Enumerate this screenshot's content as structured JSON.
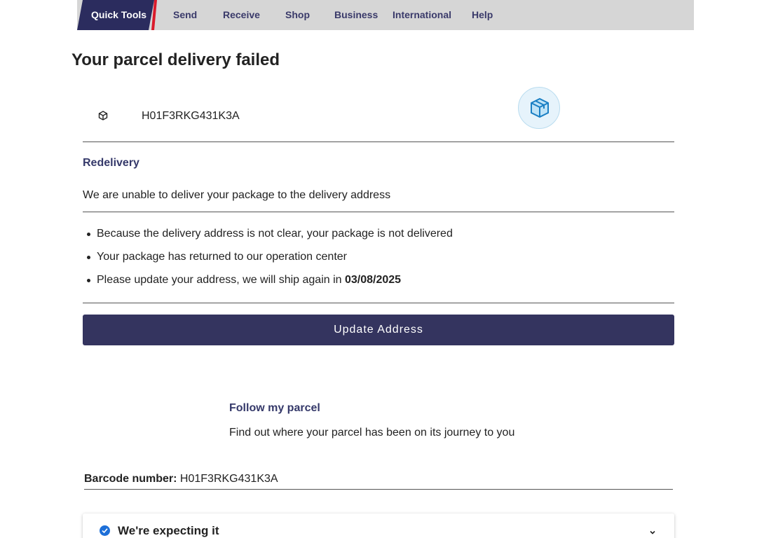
{
  "nav": {
    "items": [
      {
        "label": "Quick Tools",
        "active": true
      },
      {
        "label": "Send"
      },
      {
        "label": "Receive"
      },
      {
        "label": "Shop"
      },
      {
        "label": "Business"
      },
      {
        "label": "International"
      },
      {
        "label": "Help"
      }
    ]
  },
  "page": {
    "title": "Your parcel delivery failed"
  },
  "tracking": {
    "code": "H01F3RKG431K3A",
    "small_icon": "package-icon",
    "badge_icon": "parcel-box-icon"
  },
  "redelivery": {
    "heading": "Redelivery",
    "description": "We are unable to deliver your package to the delivery address",
    "bullets": [
      "Because the delivery address is not clear, your package is not delivered",
      "Your package has returned to our operation center",
      "Please update your address, we will ship again in"
    ],
    "ship_date": "03/08/2025",
    "button_label": "Update Address"
  },
  "follow": {
    "title": "Follow my parcel",
    "description": "Find out where your parcel has been on its journey to you"
  },
  "barcode": {
    "label": "Barcode number:",
    "value": "H01F3RKG431K3A"
  },
  "status_accordion": {
    "label": "We're expecting it",
    "icon": "check-circle-icon"
  },
  "colors": {
    "brand_navy": "#34345f",
    "accent_red": "#da1a2b",
    "heading_blue": "#35396a",
    "check_blue": "#1d6fd8"
  }
}
